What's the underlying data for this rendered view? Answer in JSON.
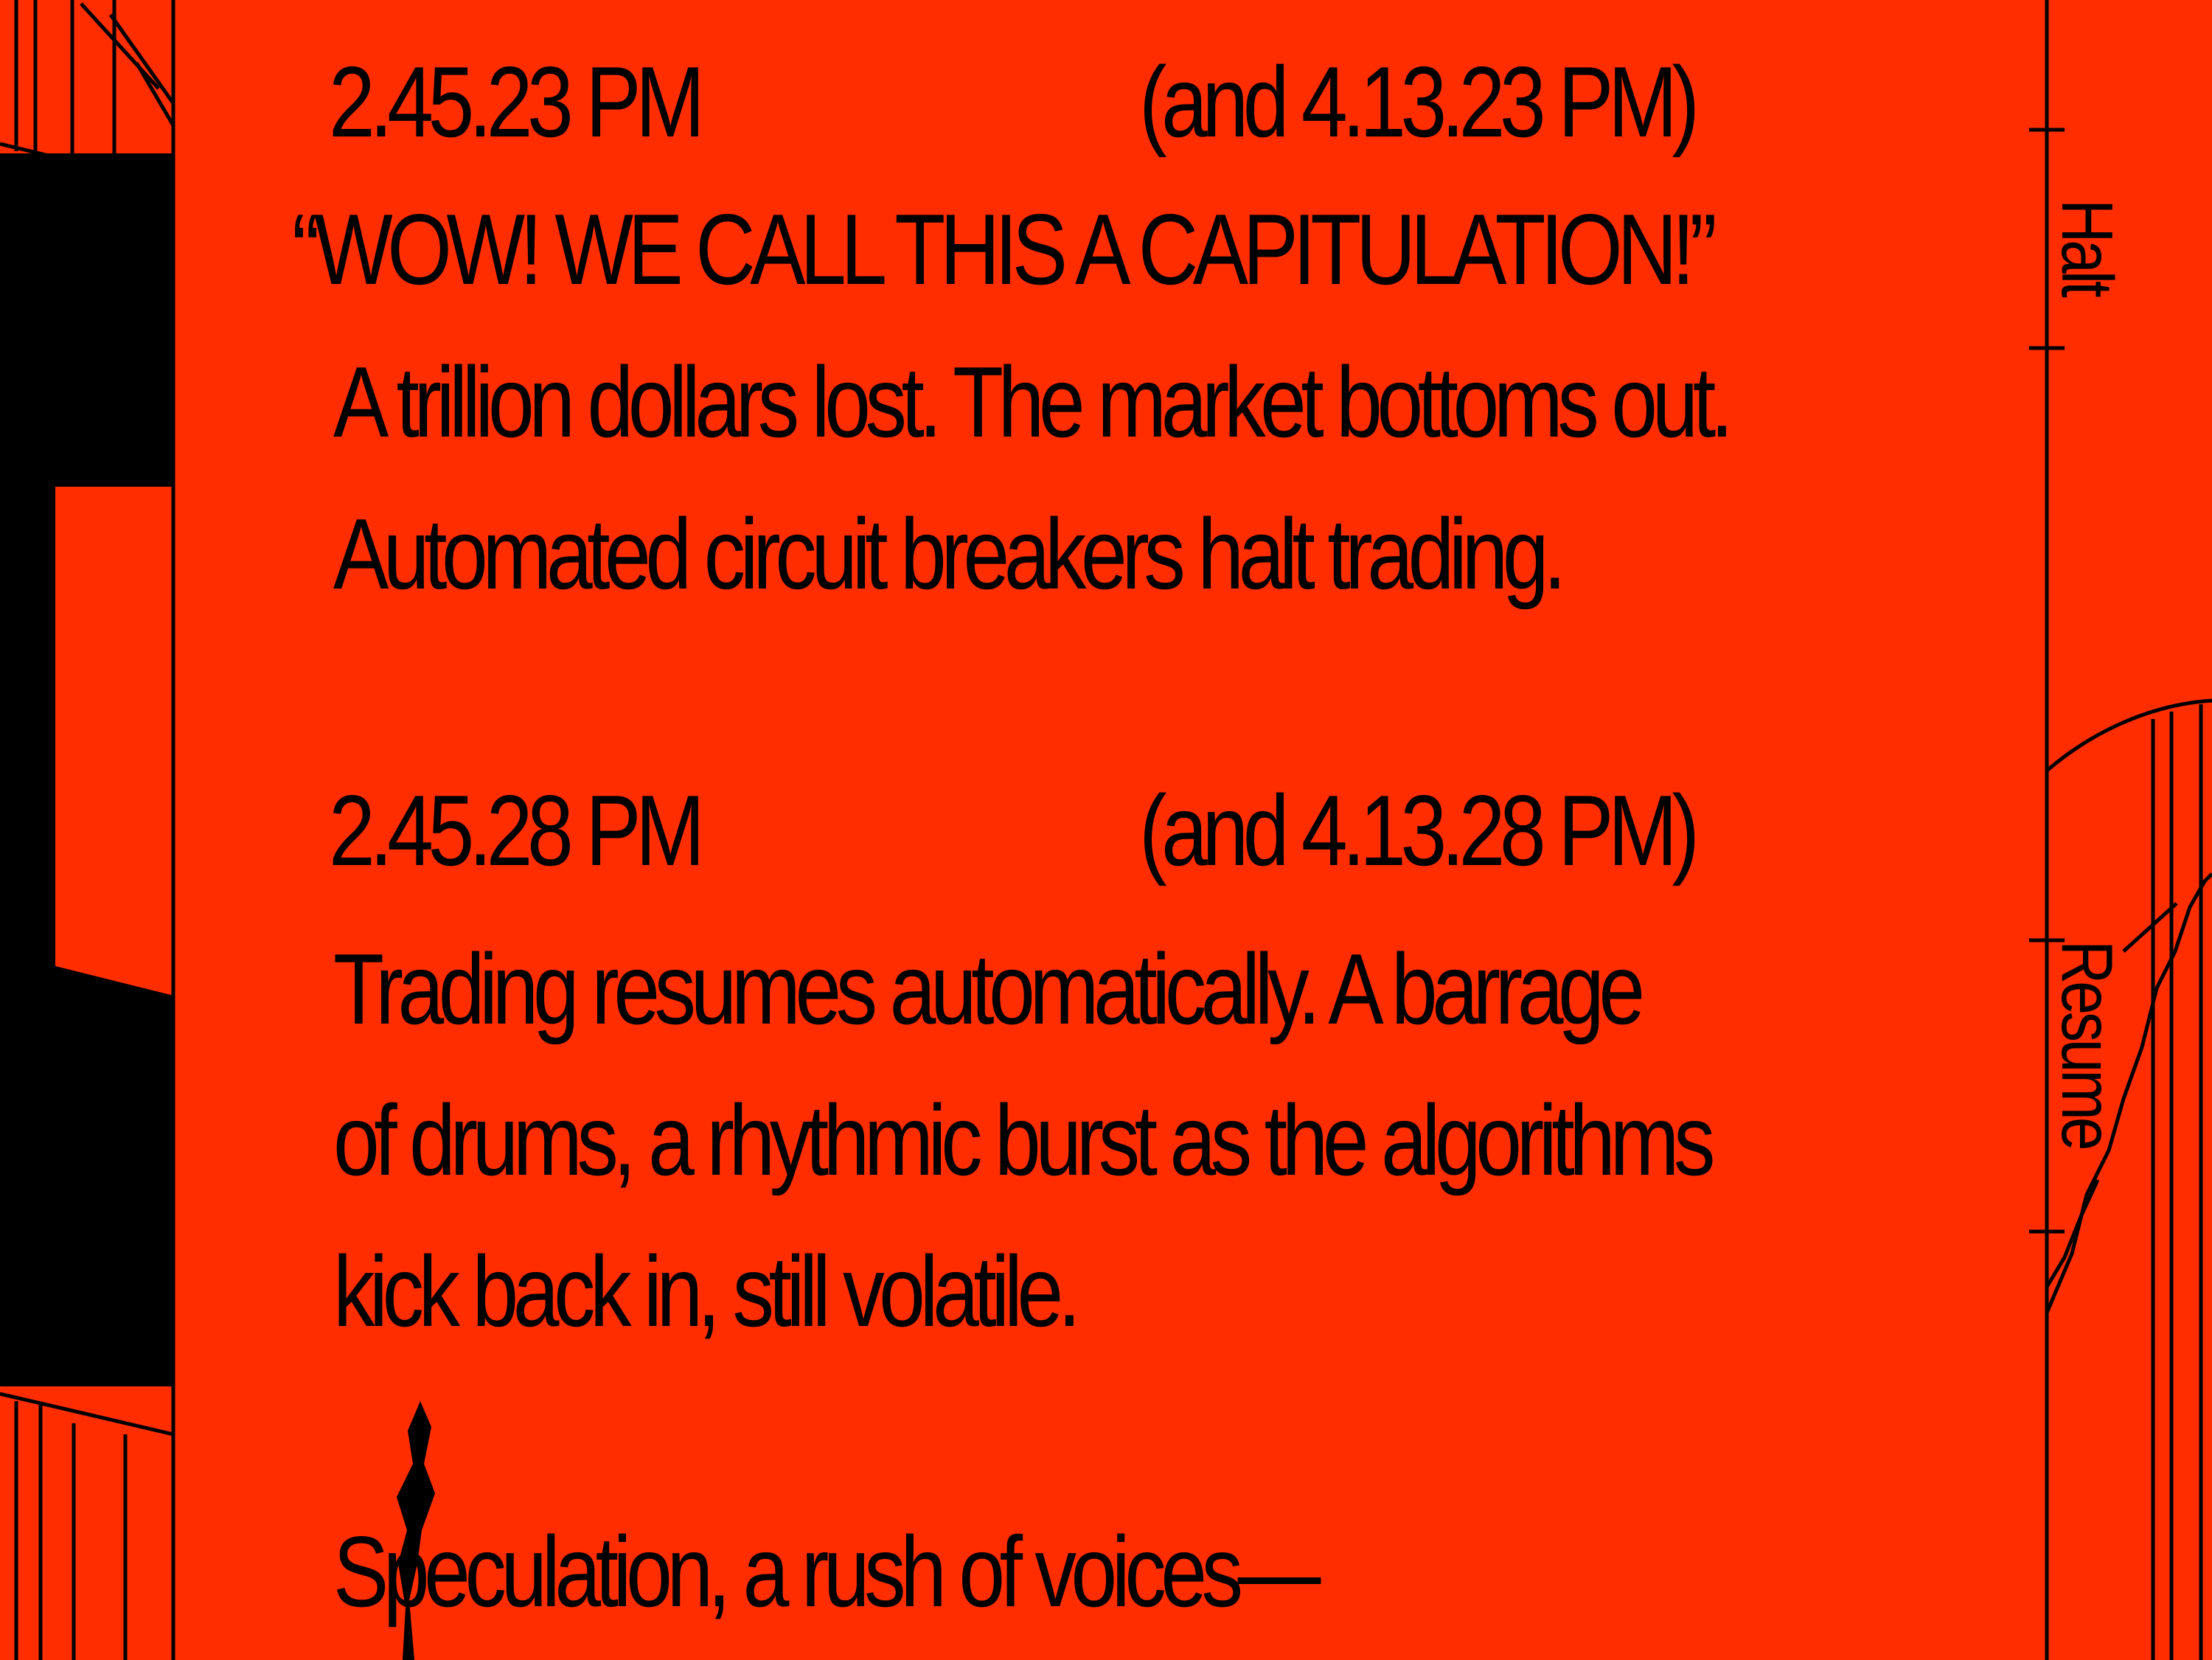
{
  "blocks": [
    {
      "time": "2.45.23 PM",
      "alt_time": "(and 4.13.23 PM)",
      "lines": [
        "“WOW! WE CALL THIS A CAPITULATION!”",
        "A trillion dollars lost. The market bottoms out.",
        "Automated circuit breakers halt trading."
      ]
    },
    {
      "time": "2.45.28 PM",
      "alt_time": "(and 4.13.28 PM)",
      "lines": [
        "Trading resumes automatically. A barrage",
        "of drums, a rhythmic burst as the algorithms",
        "kick back in, still volatile."
      ]
    }
  ],
  "closing_line": "Speculation, a rush of voices—",
  "side_labels": [
    "Halt",
    "Resume"
  ],
  "colors": {
    "background": "#ff2d00",
    "ink": "#000000"
  }
}
